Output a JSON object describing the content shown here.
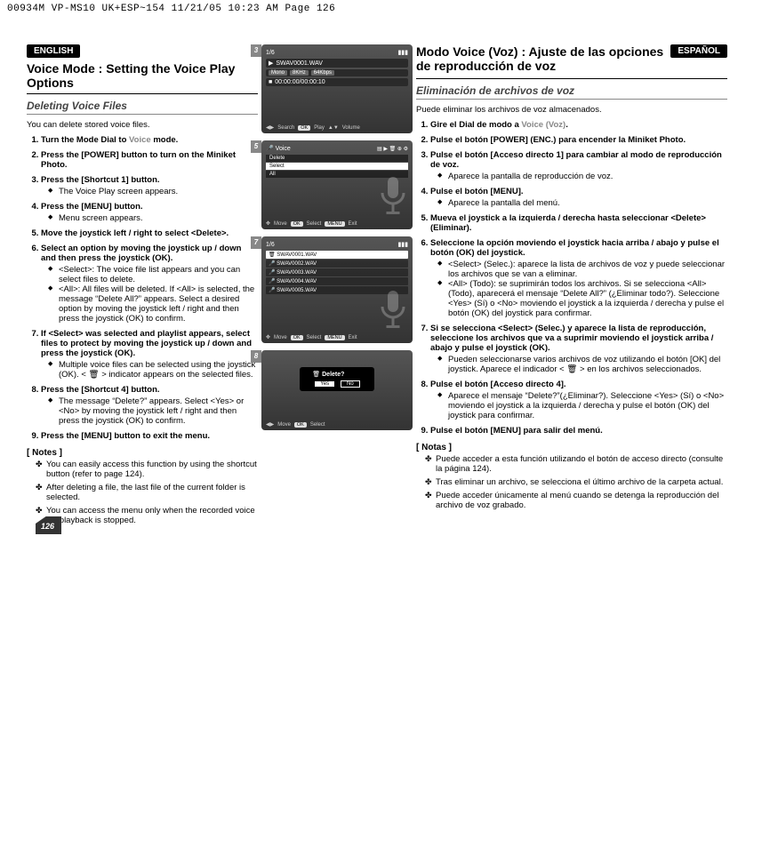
{
  "meta_header": "00934M VP-MS10 UK+ESP~154  11/21/05 10:23 AM  Page 126",
  "page_number": "126",
  "en": {
    "lang_badge": "ENGLISH",
    "title": "Voice Mode : Setting the Voice Play Options",
    "subtitle": "Deleting Voice Files",
    "intro": "You can delete stored voice files.",
    "steps": [
      {
        "t": "Turn the Mode Dial to ",
        "accent": "Voice",
        "t2": " mode."
      },
      {
        "t": "Press the [POWER] button to turn on the Miniket Photo."
      },
      {
        "t": "Press the [Shortcut 1] button.",
        "sub": [
          "The Voice Play screen appears."
        ]
      },
      {
        "t": "Press the [MENU] button.",
        "sub": [
          "Menu screen appears."
        ]
      },
      {
        "t": "Move the joystick left / right to select <Delete>."
      },
      {
        "t": "Select an option by moving the joystick up / down and then press the joystick (OK).",
        "sub": [
          "<Select>: The voice file list appears and you can select files to delete.",
          "<All>: All files will be deleted. If <All> is selected, the message “Delete All?” appears. Select a desired option by moving the joystick left / right and then press the joystick (OK) to confirm."
        ]
      },
      {
        "t": "If <Select> was selected and playlist appears, select files to protect by moving the joystick up / down and press the joystick (OK).",
        "sub": [
          "Multiple voice files can be selected using the joystick (OK). < 🗑 > indicator appears on the selected files."
        ]
      },
      {
        "t": "Press the [Shortcut 4] button.",
        "sub": [
          "The message “Delete?” appears. Select <Yes> or <No> by moving the joystick left / right and then press the joystick (OK) to confirm."
        ]
      },
      {
        "t": "Press the [MENU] button to exit the menu."
      }
    ],
    "notes_h": "[ Notes ]",
    "notes": [
      "You can easily access this function by using the shortcut button (refer to page 124).",
      "After deleting a file, the last file of the current folder is selected.",
      "You can access the menu only when the recorded voice file playback is stopped."
    ]
  },
  "es": {
    "lang_badge": "ESPAÑOL",
    "title": "Modo Voice (Voz) : Ajuste de las opciones de reproducción de voz",
    "subtitle": "Eliminación de archivos de voz",
    "intro": "Puede eliminar los archivos de voz almacenados.",
    "steps": [
      {
        "t": "Gire el Dial de modo a ",
        "accent": "Voice (Voz)",
        "t2": "."
      },
      {
        "t": "Pulse el botón [POWER] (ENC.) para encender la Miniket Photo."
      },
      {
        "t": "Pulse el botón [Acceso directo 1] para cambiar al modo de reproducción de voz.",
        "sub": [
          "Aparece la pantalla de reproducción de voz."
        ]
      },
      {
        "t": "Pulse el botón [MENU].",
        "sub": [
          "Aparece la pantalla del menú."
        ]
      },
      {
        "t": "Mueva el joystick a la izquierda / derecha hasta seleccionar <Delete> (Eliminar)."
      },
      {
        "t": "Seleccione la opción moviendo el joystick hacia arriba / abajo y pulse el botón (OK) del joystick.",
        "sub": [
          "<Select> (Selec.): aparece la lista de archivos de voz y puede seleccionar los archivos que se van a eliminar.",
          "<All> (Todo): se suprimirán todos los archivos. Si se selecciona <All> (Todo), aparecerá el mensaje “Delete All?” (¿Eliminar todo?). Seleccione <Yes> (Sí) o <No> moviendo el joystick a la izquierda / derecha y pulse el botón (OK) del joystick para confirmar."
        ]
      },
      {
        "t": "Si se selecciona <Select> (Selec.) y aparece la lista de reproducción, seleccione los archivos que va a suprimir moviendo el joystick arriba / abajo y pulse el joystick (OK).",
        "sub": [
          "Pueden seleccionarse varios archivos de voz utilizando el botón [OK] del joystick. Aparece el indicador < 🗑 > en los archivos seleccionados."
        ]
      },
      {
        "t": "Pulse el botón [Acceso directo 4].",
        "sub": [
          "Aparece el mensaje “Delete?”(¿Eliminar?). Seleccione <Yes> (Sí) o <No> moviendo el joystick a la izquierda / derecha y pulse el botón (OK) del joystick para confirmar."
        ]
      },
      {
        "t": "Pulse el botón [MENU] para salir del menú."
      }
    ],
    "notes_h": "[ Notas ]",
    "notes": [
      "Puede acceder a esta función utilizando el botón de acceso directo (consulte la página 124).",
      "Tras eliminar un archivo, se selecciona el último archivo de la carpeta actual.",
      "Puede acceder únicamente al menú cuando se detenga la reproducción del archivo de voz grabado."
    ]
  },
  "shots": {
    "s3": {
      "num": "3",
      "counter": "1/6",
      "file": "SWAV0001.WAV",
      "mode": "Mono",
      "rate": "8KHz",
      "bitrate": "64Kbps",
      "time": "00:00:00/00:00:10",
      "f1": "Search",
      "f2": "Play",
      "f3": "Volume",
      "ok": "OK"
    },
    "s5": {
      "num": "5",
      "title": "Voice",
      "m1": "Delete",
      "m2": "Select",
      "m3": "All",
      "f1": "Move",
      "ok": "OK",
      "f2": "Select",
      "f3": "MENU",
      "f4": "Exit"
    },
    "s7": {
      "num": "7",
      "counter": "1/6",
      "r0": "SWAV0001.WAV",
      "r1": "SWAV0002.WAV",
      "r2": "SWAV0003.WAV",
      "r3": "SWAV0004.WAV",
      "r4": "SWAV0005.WAV",
      "f1": "Move",
      "ok": "OK",
      "f2": "Select",
      "f3": "MENU",
      "f4": "Exit"
    },
    "s8": {
      "num": "8",
      "prompt": "Delete?",
      "yes": "Yes",
      "no": "No",
      "f1": "Move",
      "ok": "OK",
      "f2": "Select"
    }
  }
}
